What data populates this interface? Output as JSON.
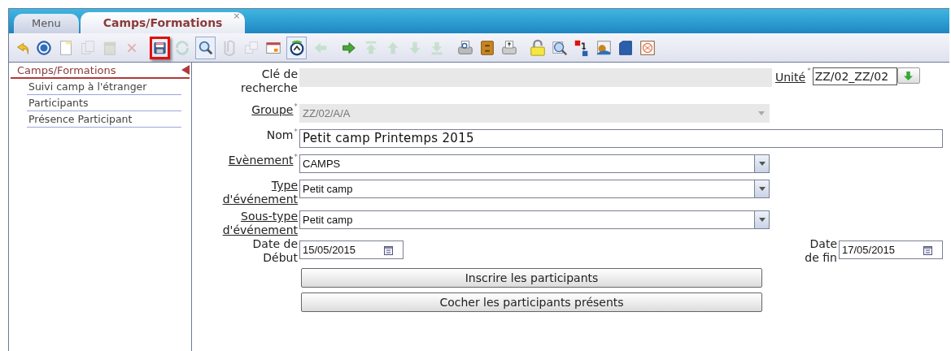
{
  "tabs": [
    {
      "label": "Menu",
      "selected": false
    },
    {
      "label": "Camps/Formations",
      "selected": true,
      "close": "×"
    }
  ],
  "toolbar": [
    {
      "kind": "undo",
      "disabled": false,
      "highlighted": false,
      "pressed": false
    },
    {
      "kind": "help",
      "disabled": false,
      "highlighted": false,
      "pressed": false
    },
    {
      "kind": "new",
      "disabled": false,
      "highlighted": false,
      "pressed": false
    },
    {
      "kind": "copy",
      "disabled": true,
      "highlighted": false,
      "pressed": false
    },
    {
      "kind": "trash",
      "disabled": true,
      "highlighted": false,
      "pressed": false
    },
    {
      "kind": "cancel",
      "disabled": true,
      "highlighted": false,
      "pressed": false
    },
    {
      "kind": "save",
      "disabled": false,
      "highlighted": true,
      "pressed": false
    },
    {
      "kind": "refresh",
      "disabled": true,
      "highlighted": false,
      "pressed": false
    },
    {
      "kind": "search",
      "disabled": false,
      "highlighted": false,
      "pressed": true
    },
    {
      "kind": "attach",
      "disabled": true,
      "highlighted": false,
      "pressed": false
    },
    {
      "kind": "duplicate",
      "disabled": true,
      "highlighted": false,
      "pressed": false
    },
    {
      "kind": "calendar",
      "disabled": false,
      "highlighted": false,
      "pressed": false
    },
    {
      "kind": "history",
      "disabled": false,
      "highlighted": false,
      "pressed": true
    },
    {
      "kind": "back",
      "disabled": true,
      "highlighted": false,
      "pressed": false
    },
    {
      "kind": "forward",
      "disabled": false,
      "highlighted": false,
      "pressed": false
    },
    {
      "kind": "first",
      "disabled": true,
      "highlighted": false,
      "pressed": false
    },
    {
      "kind": "up",
      "disabled": true,
      "highlighted": false,
      "pressed": false
    },
    {
      "kind": "down",
      "disabled": true,
      "highlighted": false,
      "pressed": false
    },
    {
      "kind": "last",
      "disabled": true,
      "highlighted": false,
      "pressed": false
    },
    {
      "kind": "preview",
      "disabled": false,
      "highlighted": false,
      "pressed": false
    },
    {
      "kind": "cabinet",
      "disabled": false,
      "highlighted": false,
      "pressed": false
    },
    {
      "kind": "print",
      "disabled": false,
      "highlighted": false,
      "pressed": false
    },
    {
      "kind": "lock",
      "disabled": false,
      "highlighted": false,
      "pressed": false
    },
    {
      "kind": "zoom",
      "disabled": false,
      "highlighted": false,
      "pressed": false
    },
    {
      "kind": "transfer",
      "disabled": false,
      "highlighted": false,
      "pressed": false
    },
    {
      "kind": "image",
      "disabled": false,
      "highlighted": false,
      "pressed": false
    },
    {
      "kind": "box",
      "disabled": false,
      "highlighted": false,
      "pressed": false
    },
    {
      "kind": "exo",
      "disabled": false,
      "highlighted": false,
      "pressed": false
    }
  ],
  "sidebar": {
    "title": "Camps/Formations",
    "items": [
      {
        "label": "Suivi camp à l'étranger"
      },
      {
        "label": "Participants"
      },
      {
        "label": "Présence Participant"
      }
    ]
  },
  "form": {
    "search_key": {
      "label": "Clé de recherche",
      "disabled": true
    },
    "unit": {
      "label": "Unité",
      "link": true,
      "required_mark": "*",
      "value": "ZZ/02_ZZ/02"
    },
    "rows": [
      {
        "kind": "select",
        "label": "Groupe",
        "link": true,
        "required_mark": "*",
        "value": "ZZ/02/A/A",
        "disabled": true
      },
      {
        "kind": "text",
        "label": "Nom",
        "link": false,
        "required_mark": "*",
        "value": "Petit camp Printemps 2015",
        "disabled": false
      },
      {
        "kind": "select",
        "label": "Evènement",
        "link": true,
        "required_mark": "*",
        "value": "CAMPS",
        "disabled": false
      },
      {
        "kind": "select",
        "label": "Type d'événement",
        "link": true,
        "value": "Petit camp",
        "disabled": false
      },
      {
        "kind": "select",
        "label": "Sous-type d'événement",
        "link": true,
        "value": "Petit camp",
        "disabled": false
      }
    ],
    "start_date": {
      "label": "Date de Début",
      "value": "15/05/2015"
    },
    "end_date": {
      "label": "Date de fin",
      "value": "17/05/2015"
    },
    "buttons": [
      "Inscrire les participants",
      "Cocher les participants présents"
    ]
  }
}
